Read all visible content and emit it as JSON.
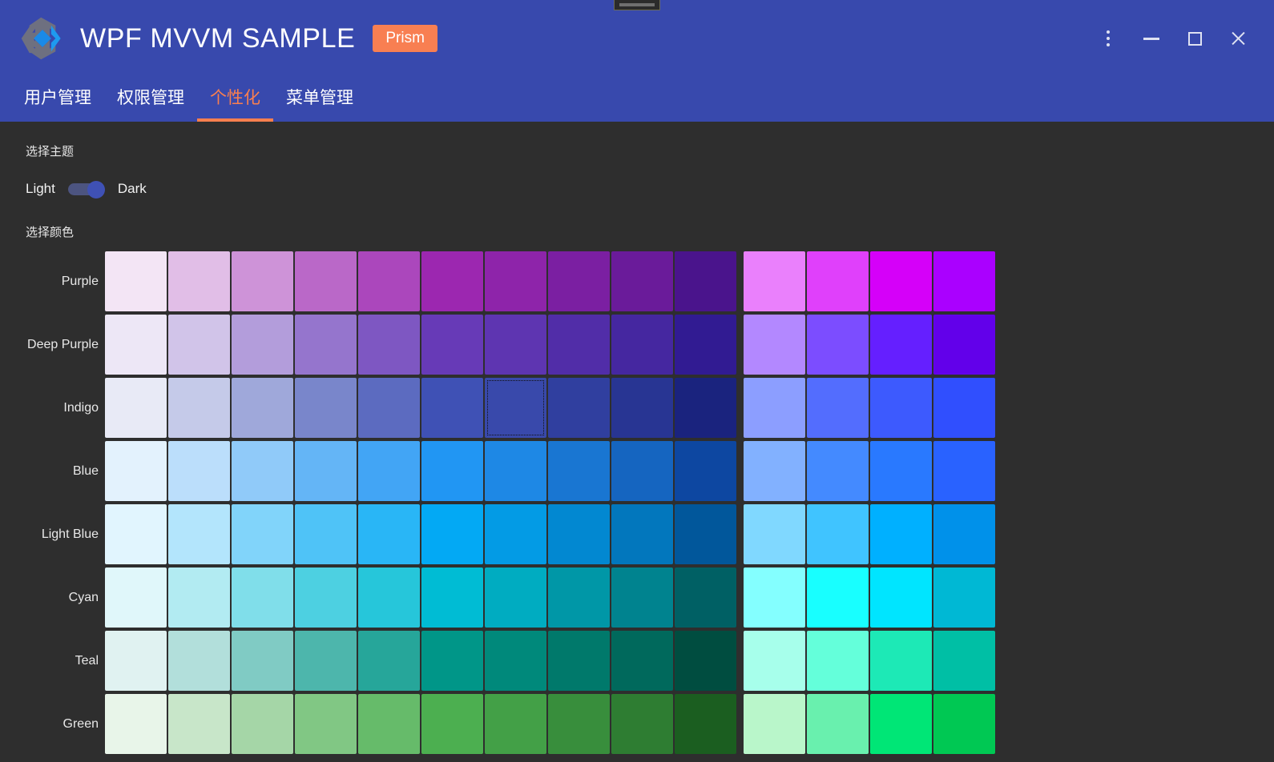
{
  "window": {
    "title": "WPF MVVM SAMPLE",
    "badge": "Prism",
    "controls": {
      "menu": "more-options",
      "minimize": "minimize",
      "maximize": "maximize",
      "close": "close"
    }
  },
  "tabs": [
    {
      "label": "用户管理",
      "active": false
    },
    {
      "label": "权限管理",
      "active": false
    },
    {
      "label": "个性化",
      "active": true
    },
    {
      "label": "菜单管理",
      "active": false
    }
  ],
  "theme": {
    "section_label": "选择主题",
    "light_label": "Light",
    "dark_label": "Dark",
    "selected": "Dark",
    "toggle_on": true
  },
  "colors": {
    "section_label": "选择颜色",
    "selected_row": "Indigo",
    "selected_index": 6,
    "rows": [
      {
        "name": "Purple",
        "shades": [
          "#f3e5f5",
          "#e1bee7",
          "#ce93d8",
          "#ba68c8",
          "#ab47bc",
          "#9c27b0",
          "#8e24aa",
          "#7b1fa2",
          "#6a1b9a",
          "#4a148c"
        ],
        "accents": [
          "#ea80fc",
          "#e040fb",
          "#d500f9",
          "#aa00ff"
        ]
      },
      {
        "name": "Deep Purple",
        "shades": [
          "#ede7f6",
          "#d1c4e9",
          "#b39ddb",
          "#9575cd",
          "#7e57c2",
          "#673ab7",
          "#5e35b1",
          "#512da8",
          "#4527a0",
          "#311b92"
        ],
        "accents": [
          "#b388ff",
          "#7c4dff",
          "#651fff",
          "#6200ea"
        ]
      },
      {
        "name": "Indigo",
        "shades": [
          "#e8eaf6",
          "#c5cae9",
          "#9fa8da",
          "#7986cb",
          "#5c6bc0",
          "#3f51b5",
          "#3949ab",
          "#303f9f",
          "#283593",
          "#1a237e"
        ],
        "accents": [
          "#8c9eff",
          "#536dfe",
          "#3d5afe",
          "#304ffe"
        ]
      },
      {
        "name": "Blue",
        "shades": [
          "#e3f2fd",
          "#bbdefb",
          "#90caf9",
          "#64b5f6",
          "#42a5f5",
          "#2196f3",
          "#1e88e5",
          "#1976d2",
          "#1565c0",
          "#0d47a1"
        ],
        "accents": [
          "#82b1ff",
          "#448aff",
          "#2979ff",
          "#2962ff"
        ]
      },
      {
        "name": "Light Blue",
        "shades": [
          "#e1f5fe",
          "#b3e5fc",
          "#81d4fa",
          "#4fc3f7",
          "#29b6f6",
          "#03a9f4",
          "#039be5",
          "#0288d1",
          "#0277bd",
          "#01579b"
        ],
        "accents": [
          "#80d8ff",
          "#40c4ff",
          "#00b0ff",
          "#0091ea"
        ]
      },
      {
        "name": "Cyan",
        "shades": [
          "#e0f7fa",
          "#b2ebf2",
          "#80deea",
          "#4dd0e1",
          "#26c6da",
          "#00bcd4",
          "#00acc1",
          "#0097a7",
          "#00838f",
          "#006064"
        ],
        "accents": [
          "#84ffff",
          "#18ffff",
          "#00e5ff",
          "#00b8d4"
        ]
      },
      {
        "name": "Teal",
        "shades": [
          "#e0f2f1",
          "#b2dfdb",
          "#80cbc4",
          "#4db6ac",
          "#26a69a",
          "#009688",
          "#00897b",
          "#00796b",
          "#00695c",
          "#004d40"
        ],
        "accents": [
          "#a7ffeb",
          "#64ffda",
          "#1de9b6",
          "#00bfa5"
        ]
      },
      {
        "name": "Green",
        "shades": [
          "#e8f5e9",
          "#c8e6c9",
          "#a5d6a7",
          "#81c784",
          "#66bb6a",
          "#4caf50",
          "#43a047",
          "#388e3c",
          "#2e7d32",
          "#1b5e20"
        ],
        "accents": [
          "#b9f6ca",
          "#69f0ae",
          "#00e676",
          "#00c853"
        ]
      }
    ]
  },
  "palette": {
    "header_bg": "#3849ad",
    "accent": "#f97f4f",
    "body_bg": "#2e2e2e"
  }
}
